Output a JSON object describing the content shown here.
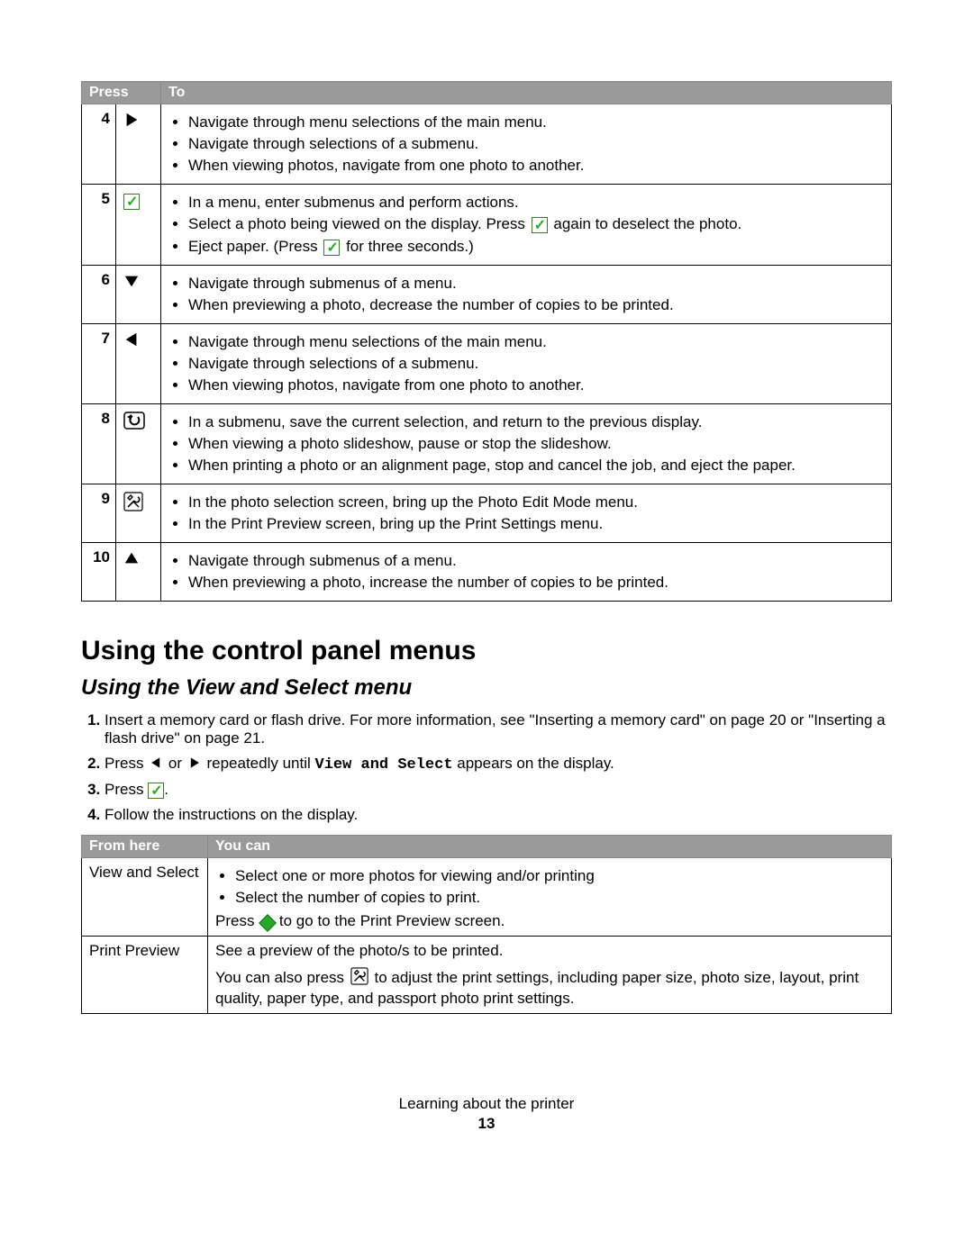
{
  "buttons_table": {
    "headers": {
      "press": "Press",
      "to": "To"
    },
    "rows": [
      {
        "num": "4",
        "icon": "right",
        "items": [
          "Navigate through menu selections of the main menu.",
          "Navigate through selections of a submenu.",
          "When viewing photos, navigate from one photo to another."
        ]
      },
      {
        "num": "5",
        "icon": "check",
        "items": [
          "In a menu, enter submenus and perform actions.",
          {
            "pre": "Select a photo being viewed on the display. Press ",
            "icon": "check",
            "post": " again to deselect the photo."
          },
          {
            "pre": "Eject paper. (Press ",
            "icon": "check",
            "post": " for three seconds.)"
          }
        ]
      },
      {
        "num": "6",
        "icon": "down",
        "items": [
          "Navigate through submenus of a menu.",
          "When previewing a photo, decrease the number of copies to be printed."
        ]
      },
      {
        "num": "7",
        "icon": "left",
        "items": [
          "Navigate through menu selections of the main menu.",
          "Navigate through selections of a submenu.",
          "When viewing photos, navigate from one photo to another."
        ]
      },
      {
        "num": "8",
        "icon": "back",
        "items": [
          "In a submenu, save the current selection, and return to the previous display.",
          "When viewing a photo slideshow, pause or stop the slideshow.",
          "When printing a photo or an alignment page, stop and cancel the job, and eject the paper."
        ]
      },
      {
        "num": "9",
        "icon": "tools",
        "items": [
          "In the photo selection screen, bring up the Photo Edit Mode menu.",
          "In the Print Preview screen, bring up the Print Settings menu."
        ]
      },
      {
        "num": "10",
        "icon": "up",
        "items": [
          "Navigate through submenus of a menu.",
          "When previewing a photo, increase the number of copies to be printed."
        ]
      }
    ]
  },
  "heading1": "Using the control panel menus",
  "heading2": "Using the View and Select menu",
  "steps": {
    "s1": "Insert a memory card or flash drive. For more information, see \"Inserting a memory card\" on page 20 or \"Inserting a flash drive\" on page 21.",
    "s2_pre": "Press ",
    "s2_mid": " or ",
    "s2_mid2": " repeatedly until ",
    "s2_code": "View and Select",
    "s2_post": " appears on the display.",
    "s3_pre": "Press ",
    "s3_post": ".",
    "s4": "Follow the instructions on the display."
  },
  "actions_table": {
    "headers": {
      "from": "From here",
      "can": "You can"
    },
    "rows": [
      {
        "from": "View and Select",
        "items": [
          "Select one or more photos for viewing and/or printing",
          "Select the number of copies to print."
        ],
        "extra_pre": "Press ",
        "extra_post": " to go to the Print Preview screen."
      },
      {
        "from": "Print Preview",
        "line1": "See a preview of the photo/s to be printed.",
        "line2_pre": "You can also press ",
        "line2_post": " to adjust the print settings, including paper size, photo size, layout, print quality, paper type, and passport photo print settings."
      }
    ]
  },
  "footer": {
    "chapter": "Learning about the printer",
    "page": "13"
  }
}
